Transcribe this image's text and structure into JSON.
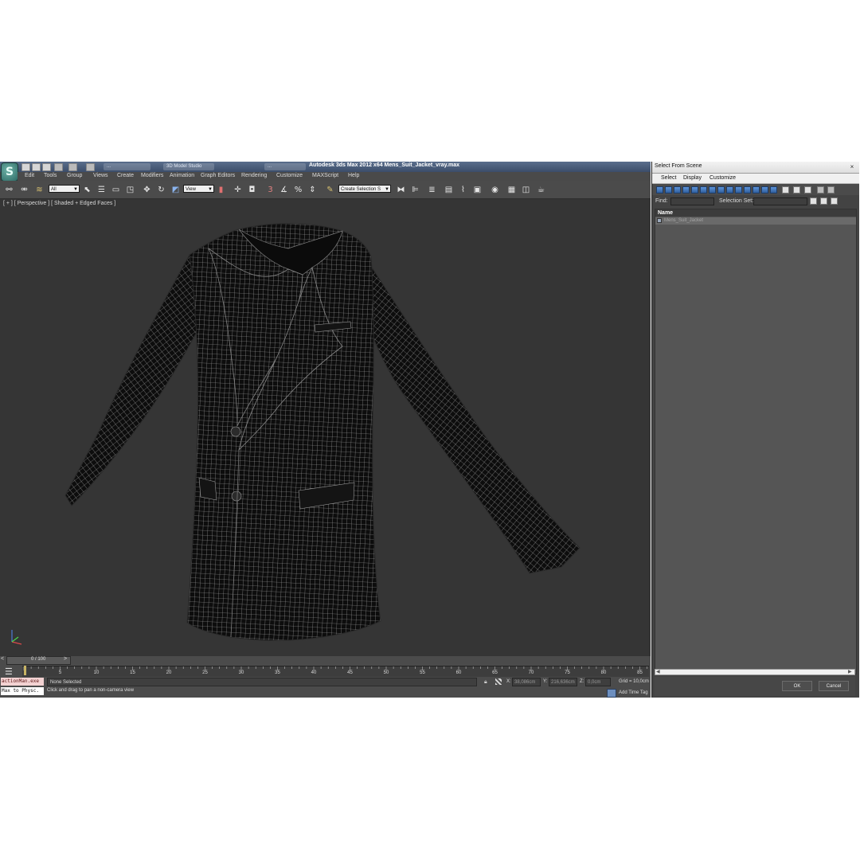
{
  "app": {
    "title": "Autodesk 3ds Max  2012 x64      Mens_Suit_Jacket_vray.max",
    "logo_letter": "S",
    "menus": [
      "Edit",
      "Tools",
      "Group",
      "Views",
      "Create",
      "Modifiers",
      "Animation",
      "Graph Editors",
      "Rendering",
      "Customize",
      "MAXScript",
      "Help"
    ],
    "background_tabs": [
      "...",
      "3D Model Studio",
      "..."
    ]
  },
  "toolbar": {
    "selection_filter": "All",
    "coord_system": "View",
    "named_selection": "Create Selection S"
  },
  "viewport": {
    "label": "[ + ] [ Perspective ] [ Shaded + Edged Faces ]",
    "object": "Mens_Suit_Jacket (wireframe mesh)"
  },
  "timeline": {
    "slider_text": "0 / 100",
    "ticks": [
      "5",
      "10",
      "15",
      "20",
      "25",
      "30",
      "35",
      "40",
      "45",
      "50",
      "55",
      "60",
      "65",
      "70",
      "75",
      "80",
      "85"
    ]
  },
  "status": {
    "listener_top": "actionMan.exe",
    "listener_bottom": "Max to Physc.",
    "selection": "None Selected",
    "prompt": "Click and drag to pan a non-camera view",
    "x_label": "X:",
    "x_value": "38,086cm",
    "y_label": "Y:",
    "y_value": "216,636cm",
    "z_label": "Z:",
    "z_value": "0,0cm",
    "grid": "Grid = 10,0cm",
    "add_time_tag": "Add Time Tag"
  },
  "dialog": {
    "title": "Select From Scene",
    "close_glyph": "×",
    "menus": [
      "Select",
      "Display",
      "Customize"
    ],
    "find_label": "Find:",
    "selection_set_label": "Selection Set:",
    "column_name": "Name",
    "rows": [
      "Mens_Suit_Jacket"
    ],
    "ok": "OK",
    "cancel": "Cancel"
  },
  "colors": {
    "viewport_bg": "#353535",
    "ui_bg": "#444444",
    "title_bar": "#3b4d6a",
    "wire": "#b8b8b8",
    "mesh_fill": "#0d0d0d"
  }
}
